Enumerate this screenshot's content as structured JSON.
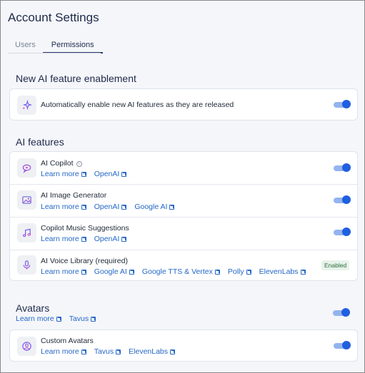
{
  "page": {
    "title": "Account Settings"
  },
  "tabs": [
    {
      "label": "Users"
    },
    {
      "label": "Permissions"
    }
  ],
  "new_ai": {
    "section_title": "New AI feature enablement",
    "item": {
      "label": "Automatically enable new AI features as they are released",
      "icon": "sparkles-icon",
      "enabled": true
    }
  },
  "ai_features": {
    "section_title": "AI features",
    "items": [
      {
        "title": "AI Copilot",
        "icon": "copilot-icon",
        "links": [
          "Learn more",
          "OpenAI"
        ],
        "enabled": true
      },
      {
        "title": "AI Image Generator",
        "icon": "image-icon",
        "links": [
          "Learn more",
          "OpenAI",
          "Google AI"
        ],
        "enabled": true
      },
      {
        "title": "Copilot Music Suggestions",
        "icon": "music-icon",
        "links": [
          "Learn more",
          "OpenAI"
        ],
        "enabled": true
      },
      {
        "title": "AI Voice Library (required)",
        "icon": "microphone-icon",
        "links": [
          "Learn more",
          "Google AI",
          "Google TTS & Vertex",
          "Polly",
          "ElevenLabs"
        ],
        "status": "Enabled"
      }
    ]
  },
  "avatars": {
    "section_title": "Avatars",
    "links": [
      "Learn more",
      "Tavus"
    ],
    "enabled": true,
    "item": {
      "title": "Custom Avatars",
      "icon": "avatar-icon",
      "links": [
        "Learn more",
        "Tavus",
        "ElevenLabs"
      ],
      "enabled": true
    }
  },
  "colors": {
    "accent": "#1f5fe0",
    "link": "#2467c7",
    "title": "#1e2a4a"
  }
}
